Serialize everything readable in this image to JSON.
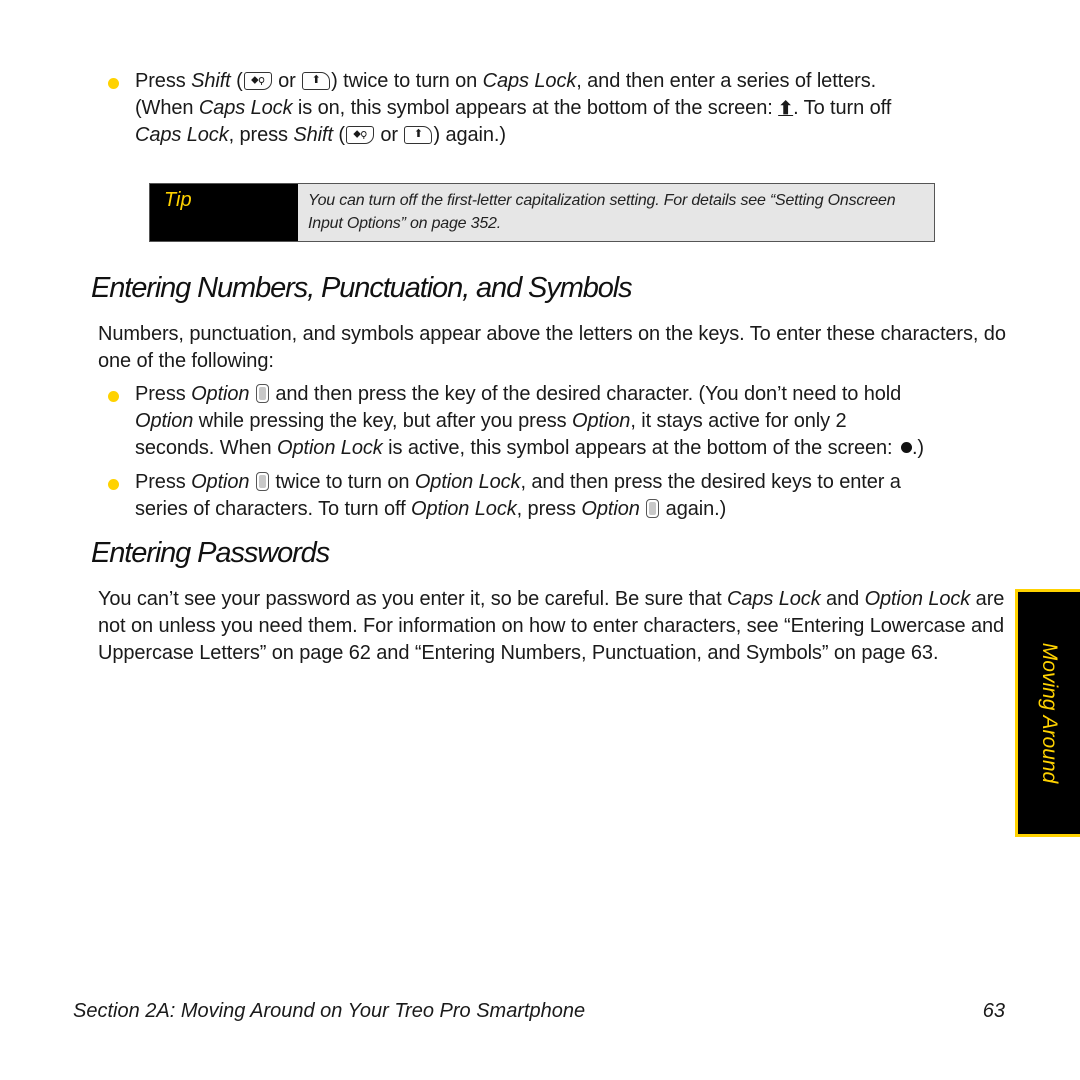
{
  "bullets_top": [
    {
      "parts": {
        "p0": "Press ",
        "p1": "Shift",
        "p2": " (",
        "p3": " or ",
        "p4": ") twice to turn on ",
        "p5": "Caps Lock",
        "p6": ", and then enter a series of letters. (When ",
        "p7": "Caps Lock",
        "p8": " is on, this symbol appears at the bottom of the screen: ",
        "p9": ". To turn off ",
        "p10": "Caps Lock",
        "p11": ", press ",
        "p12": "Shift",
        "p13": " (",
        "p14": " or ",
        "p15": ") again.)"
      },
      "icons": {
        "shift_key_a": "⬥⚲",
        "shift_key_b": "⬆",
        "caps_lock_symbol": "⬆"
      }
    }
  ],
  "tip": {
    "label": "Tip",
    "text": "You can turn off the first-letter capitalization setting. For details see “Setting Onscreen Input Options” on page 352."
  },
  "section1": {
    "heading": "Entering Numbers, Punctuation, and Symbols",
    "intro": "Numbers, punctuation, and symbols appear above the letters on the keys. To enter these characters, do one of the following:",
    "bullets": [
      {
        "p0": "Press ",
        "p1": "Option",
        "p2": " and then press the key of the desired character. (You don’t need to hold ",
        "p3": "Option",
        "p4": " while pressing the key, but after you press ",
        "p5": "Option",
        "p6": ", it stays active for only 2 seconds. When ",
        "p7": "Option Lock",
        "p8": " is active, this symbol appears at the bottom of the screen: ",
        "p9": ".)"
      },
      {
        "p0": "Press ",
        "p1": "Option",
        "p2": " twice to turn on ",
        "p3": "Option Lock",
        "p4": ", and then press the desired keys to enter a series of characters. To turn off ",
        "p5": "Option Lock",
        "p6": ", press ",
        "p7": "Option",
        "p8": " again.)"
      }
    ]
  },
  "section2": {
    "heading": "Entering Passwords",
    "p0": "You can’t see your password as you enter it, so be careful. Be sure that ",
    "p1": "Caps Lock",
    "p2": " and ",
    "p3": "Option Lock",
    "p4": " are not on unless you need them. For information on how to enter characters, see “Entering Lowercase and Uppercase Letters” on page 62 and “Entering Numbers, Punctuation, and Symbols” on page 63."
  },
  "side_tab": {
    "label": "Moving Around"
  },
  "footer": {
    "section_title": "Section 2A: Moving Around on Your Treo Pro Smartphone",
    "page_number": "63"
  },
  "colors": {
    "accent": "#ffd200",
    "tip_bg": "#e6e6e6",
    "dark": "#000000"
  }
}
